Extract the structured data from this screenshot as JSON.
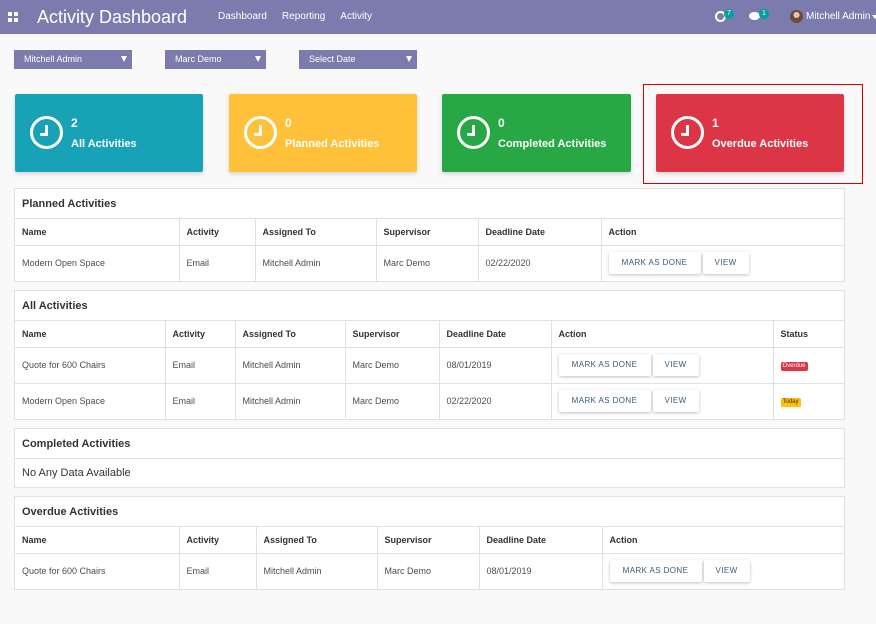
{
  "navbar": {
    "title": "Activity Dashboard",
    "menu": [
      "Dashboard",
      "Reporting",
      "Activity"
    ],
    "activity_count": "7",
    "message_count": "1",
    "user_name": "Mitchell Admin"
  },
  "filters": {
    "user": "Mitchell Admin",
    "supervisor": "Marc Demo",
    "date": "Select Date"
  },
  "cards": [
    {
      "count": "2",
      "label": "All Activities",
      "color": "#17a2b8"
    },
    {
      "count": "0",
      "label": "Planned Activities",
      "color": "#ffc03a"
    },
    {
      "count": "0",
      "label": "Completed Activities",
      "color": "#28a745"
    },
    {
      "count": "1",
      "label": "Overdue Activities",
      "color": "#dc3545"
    }
  ],
  "headers": {
    "name": "Name",
    "activity": "Activity",
    "assigned": "Assigned To",
    "supervisor": "Supervisor",
    "deadline": "Deadline Date",
    "action": "Action",
    "status": "Status"
  },
  "buttons": {
    "done": "MARK AS DONE",
    "view": "VIEW"
  },
  "planned": {
    "title": "Planned Activities",
    "rows": [
      {
        "name": "Modern Open Space",
        "activity": "Email",
        "assigned": "Mitchell Admin",
        "supervisor": "Marc Demo",
        "deadline": "02/22/2020"
      }
    ]
  },
  "all": {
    "title": "All Activities",
    "rows": [
      {
        "name": "Quote for 600 Chairs",
        "activity": "Email",
        "assigned": "Mitchell Admin",
        "supervisor": "Marc Demo",
        "deadline": "08/01/2019",
        "status": "Overdue"
      },
      {
        "name": "Modern Open Space",
        "activity": "Email",
        "assigned": "Mitchell Admin",
        "supervisor": "Marc Demo",
        "deadline": "02/22/2020",
        "status": "Today"
      }
    ]
  },
  "completed": {
    "title": "Completed Activities",
    "empty": "No Any Data Available"
  },
  "overdue": {
    "title": "Overdue Activities",
    "rows": [
      {
        "name": "Quote for 600 Chairs",
        "activity": "Email",
        "assigned": "Mitchell Admin",
        "supervisor": "Marc Demo",
        "deadline": "08/01/2019"
      }
    ]
  }
}
